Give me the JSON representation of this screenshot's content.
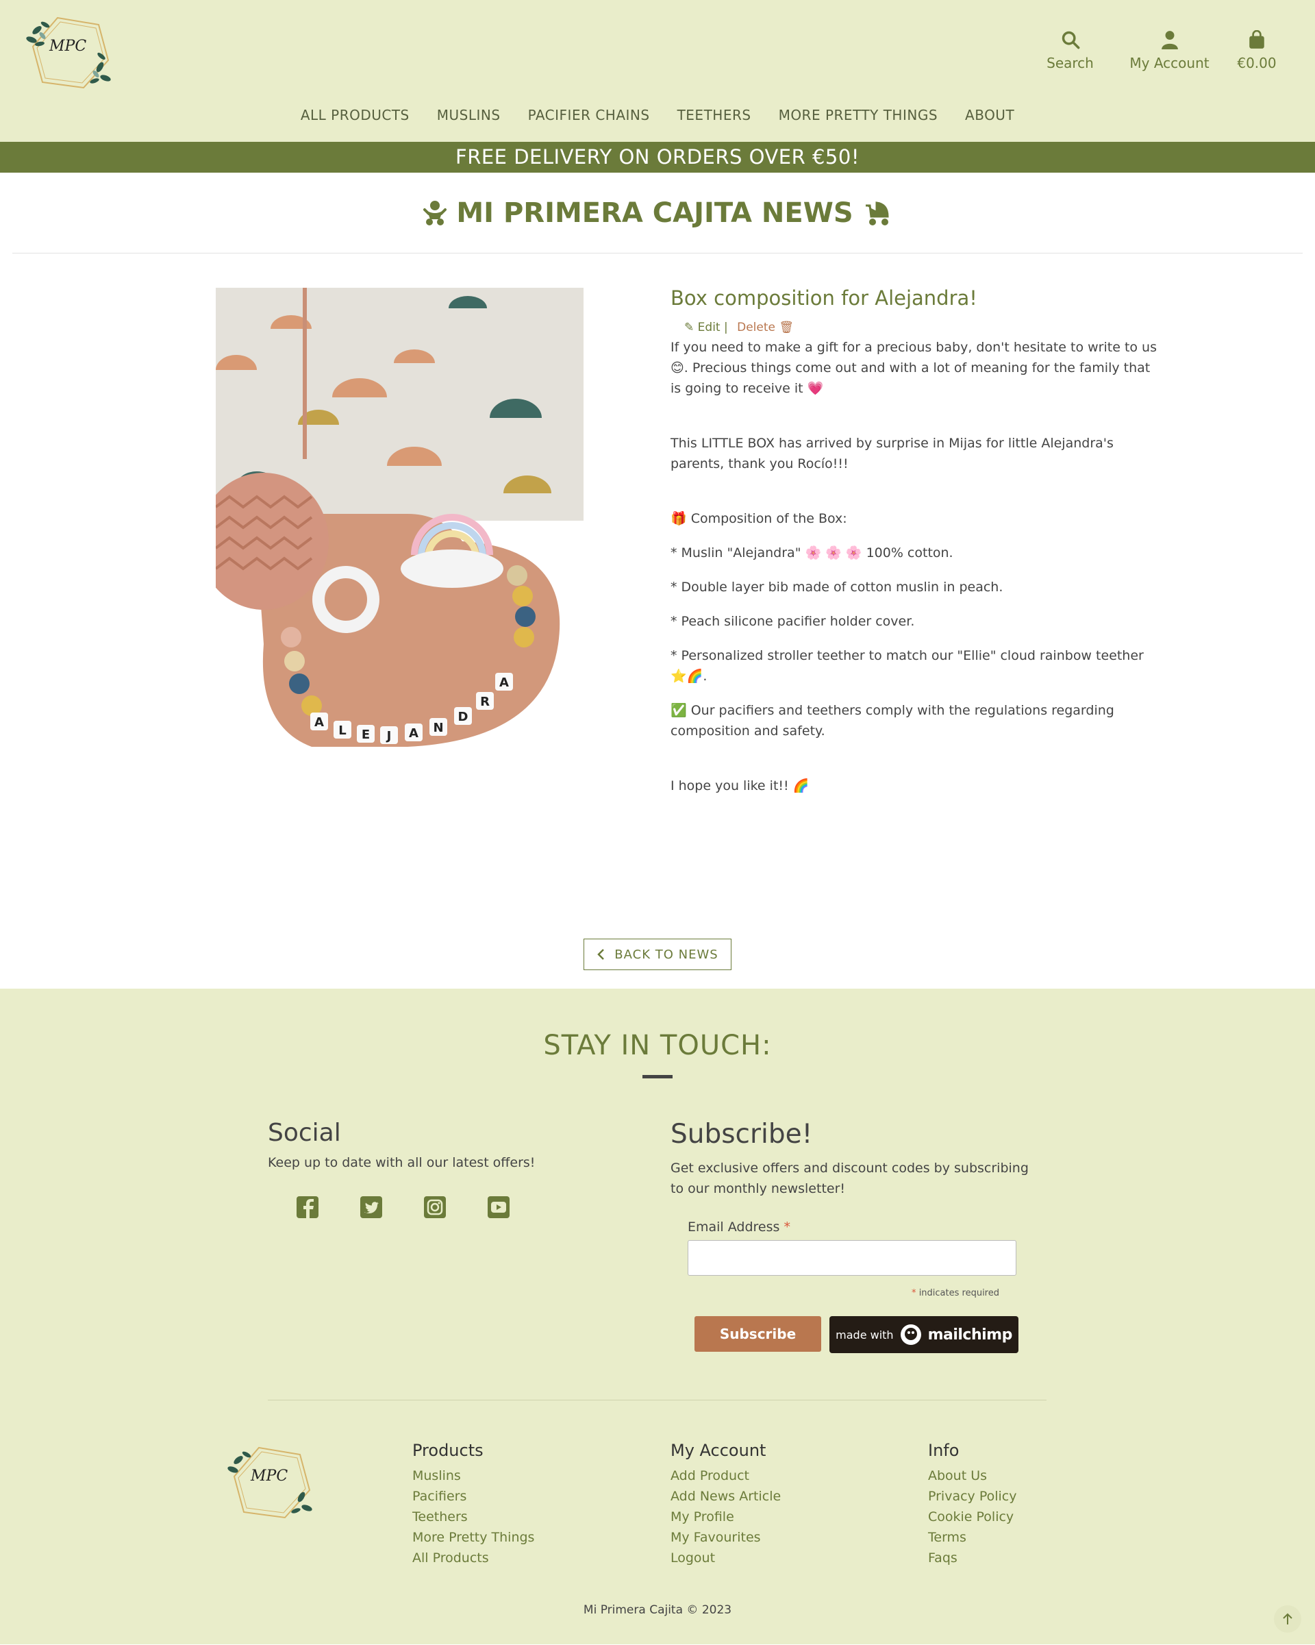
{
  "header": {
    "logo_text": "MPC",
    "search_label": "Search",
    "account_label": "My Account",
    "cart_label": "€0.00",
    "nav": [
      "ALL PRODUCTS",
      "MUSLINS",
      "PACIFIER CHAINS",
      "TEETHERS",
      "MORE PRETTY THINGS",
      "ABOUT"
    ],
    "banner": "FREE DELIVERY ON ORDERS OVER €50!"
  },
  "page": {
    "title": "MI PRIMERA CAJITA NEWS",
    "title_icon_left": "baby-icon",
    "title_icon_right": "stroller-icon"
  },
  "article": {
    "title": "Box composition for Alejandra!",
    "edit_label": "Edit |",
    "delete_label": "Delete",
    "paragraphs": [
      "If you need to make a gift for a precious baby, don't hesitate to write to us 😊. Precious things come out and with a lot of meaning for the family that is going to receive it 💗",
      "This LITTLE BOX has arrived by surprise in Mijas for little Alejandra's parents, thank you Rocío!!!",
      "🎁 Composition of the Box:",
      "* Muslin \"Alejandra\" 🌸 🌸 🌸 100% cotton.",
      "* Double layer bib made of cotton muslin in peach.",
      "* Peach silicone pacifier holder cover.",
      "* Personalized stroller teether to match our \"Ellie\" cloud rainbow teether ⭐🌈.",
      "✅ Our pacifiers and teethers comply with the regulations regarding composition and safety.",
      "I hope you like it!! 🌈"
    ],
    "beads": [
      "A",
      "L",
      "E",
      "J",
      "A",
      "N",
      "D",
      "R",
      "A"
    ],
    "back_label": "BACK TO NEWS"
  },
  "footer": {
    "heading": "STAY IN TOUCH:",
    "social_title": "Social",
    "social_text": "Keep up to date with all our latest offers!",
    "social_icons": [
      "facebook-icon",
      "twitter-icon",
      "instagram-icon",
      "youtube-icon"
    ],
    "subscribe_title": "Subscribe!",
    "subscribe_text": "Get exclusive offers and discount codes by subscribing to our monthly newsletter!",
    "email_label": "Email Address",
    "required_star": "*",
    "required_note": "indicates required",
    "subscribe_button": "Subscribe",
    "mailchimp_prefix": "made with",
    "mailchimp_brand": "mailchimp",
    "columns": [
      {
        "title": "Products",
        "links": [
          "Muslins",
          "Pacifiers",
          "Teethers",
          "More Pretty Things",
          "All Products"
        ]
      },
      {
        "title": "My Account",
        "links": [
          "Add Product",
          "Add News Article",
          "My Profile",
          "My Favourites",
          "Logout"
        ]
      },
      {
        "title": "Info",
        "links": [
          "About Us",
          "Privacy Policy",
          "Cookie Policy",
          "Terms",
          "Faqs"
        ]
      }
    ],
    "copyright": "Mi Primera Cajita © 2023"
  },
  "colors": {
    "olive": "#6b7b3a",
    "cream": "#e9edca",
    "peach": "#b9774f",
    "mailchimp_dark": "#241c15"
  }
}
